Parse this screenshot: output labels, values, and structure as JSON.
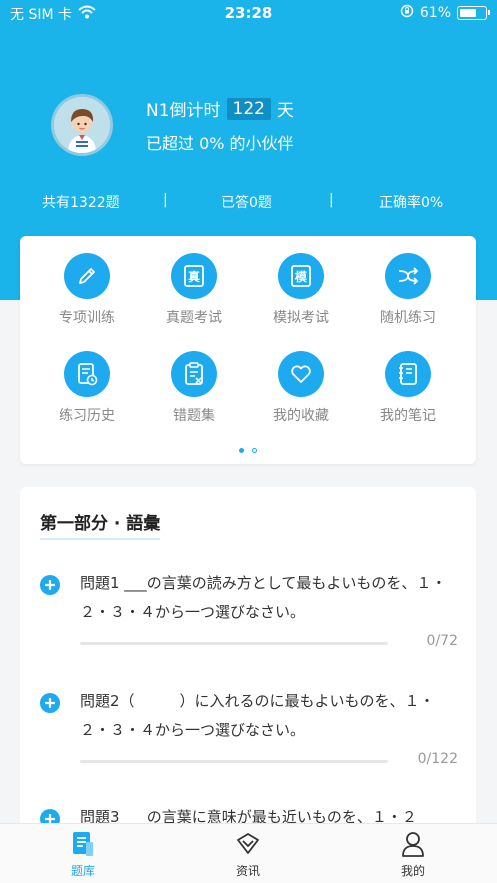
{
  "status_bar": {
    "carrier": "无 SIM 卡",
    "time": "23:28",
    "battery": "61%"
  },
  "header": {
    "countdown_prefix": "N1倒计时",
    "countdown_days": "122",
    "countdown_suffix": "天",
    "surpass_text": "已超过 0% 的小伙伴"
  },
  "stats": {
    "total": "共有1322题",
    "answered": "已答0题",
    "accuracy": "正确率0%",
    "separator": "|"
  },
  "features": [
    {
      "label": "专项训练",
      "icon": "pencil-icon"
    },
    {
      "label": "真题考试",
      "icon": "real-exam-icon",
      "glyph": "真"
    },
    {
      "label": "模拟考试",
      "icon": "mock-exam-icon",
      "glyph": "模"
    },
    {
      "label": "随机练习",
      "icon": "shuffle-icon"
    },
    {
      "label": "练习历史",
      "icon": "history-icon"
    },
    {
      "label": "错题集",
      "icon": "wrong-questions-icon"
    },
    {
      "label": "我的收藏",
      "icon": "heart-icon"
    },
    {
      "label": "我的笔记",
      "icon": "notebook-icon"
    }
  ],
  "section": {
    "title": "第一部分 · 語彙",
    "questions": [
      {
        "text": "問題1 ___の言葉の読み方として最もよいものを、１・２・３・４から一つ選びなさい。",
        "progress": "0/72",
        "progress_fraction": 0
      },
      {
        "text": "問題2（　　　）に入れるのに最もよいものを、１・２・３・４から一つ選びなさい。",
        "progress": "0/122",
        "progress_fraction": 0
      },
      {
        "text": "問題3 ___の言葉に意味が最も近いものを、１・２",
        "progress": "",
        "progress_fraction": 0
      }
    ]
  },
  "tabs": [
    {
      "label": "题库",
      "icon": "question-bank-icon",
      "active": true
    },
    {
      "label": "资讯",
      "icon": "news-icon",
      "active": false
    },
    {
      "label": "我的",
      "icon": "profile-icon",
      "active": false
    }
  ],
  "colors": {
    "primary": "#1ab3ea",
    "icon_bg": "#1eaaee",
    "inactive_tab": "#333333"
  }
}
